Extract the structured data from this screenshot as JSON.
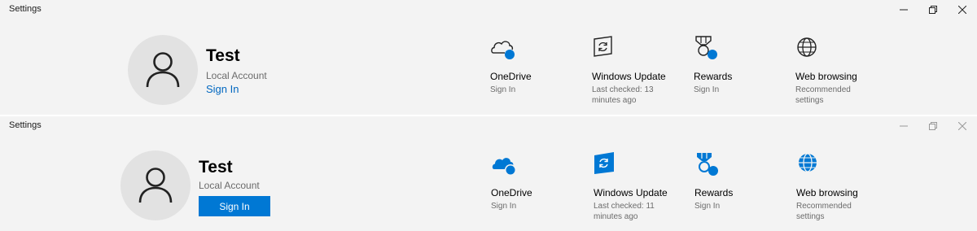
{
  "windows": [
    {
      "app_title": "Settings",
      "style": "outline",
      "account": {
        "name": "Test",
        "type": "Local Account",
        "sign_in": "Sign In"
      },
      "tiles": {
        "onedrive": {
          "title": "OneDrive",
          "subtitle": "Sign In",
          "icon": "cloud-icon"
        },
        "update": {
          "title": "Windows Update",
          "subtitle": "Last checked: 13 minutes ago",
          "icon": "sync-icon"
        },
        "rewards": {
          "title": "Rewards",
          "subtitle": "Sign In",
          "icon": "medal-icon"
        },
        "web": {
          "title": "Web browsing",
          "subtitle": "Recommended settings",
          "icon": "globe-icon"
        }
      }
    },
    {
      "app_title": "Settings",
      "style": "filled",
      "account": {
        "name": "Test",
        "type": "Local Account",
        "sign_in": "Sign In"
      },
      "tiles": {
        "onedrive": {
          "title": "OneDrive",
          "subtitle": "Sign In",
          "icon": "cloud-icon"
        },
        "update": {
          "title": "Windows Update",
          "subtitle": "Last checked: 11 minutes ago",
          "icon": "sync-icon"
        },
        "rewards": {
          "title": "Rewards",
          "subtitle": "Sign In",
          "icon": "medal-icon"
        },
        "web": {
          "title": "Web browsing",
          "subtitle": "Recommended settings",
          "icon": "globe-icon"
        }
      }
    }
  ],
  "window_controls": [
    "minimize-icon",
    "restore-icon",
    "close-icon"
  ],
  "colors": {
    "accent": "#0078d4",
    "link": "#0067c0",
    "background": "#f3f3f3",
    "avatar_bg": "#e2e2e2",
    "secondary_text": "#6b6b6b"
  }
}
